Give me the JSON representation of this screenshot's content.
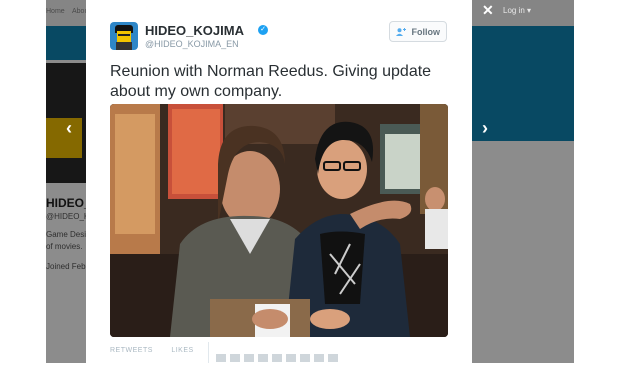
{
  "background_page": {
    "header_color": "#0f86b4",
    "name_fragment": "HIDEO_KO",
    "handle_fragment": "@HIDEO_KOJIM",
    "bio_line1": "Game Designer:",
    "bio_line2": "of movies.",
    "joined_fragment": "Joined Febru",
    "login_label": "Log in ▾",
    "top_left_fragment_1": "Home",
    "top_left_fragment_2": "About"
  },
  "modal": {
    "display_name": "HIDEO_KOJIMA",
    "verified_badge": "✓",
    "handle": "@HIDEO_KOJIMA_EN",
    "follow_label": "Follow",
    "follow_icon": "add-user-icon",
    "tweet_text": "Reunion with Norman Reedus. Giving update about my own company.",
    "photo_alt": "Two men posing together in a restaurant",
    "retweets_label": "RETWEETS",
    "likes_label": "LIKES"
  },
  "controls": {
    "close": "✕",
    "prev_arrow": "‹",
    "next_arrow": "›"
  },
  "colors": {
    "accent": "#1da1f2",
    "overlay": "rgba(0,0,0,0.45)"
  }
}
